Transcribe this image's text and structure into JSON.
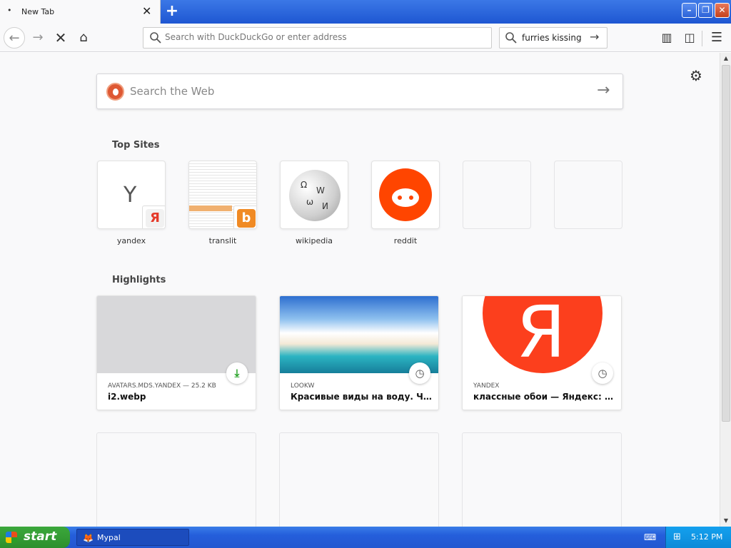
{
  "tab": {
    "title": "New Tab",
    "close": "✕",
    "new_tab": "+"
  },
  "window": {
    "minimize": "–",
    "maximize": "❐",
    "close": "✕"
  },
  "toolbar": {
    "back": "←",
    "forward": "→",
    "stop": "✕",
    "home": "⌂",
    "url_placeholder": "Search with DuckDuckGo or enter address",
    "search_value": "furries kissing",
    "search_go": "→",
    "library": "▥",
    "sidebar": "◫",
    "menu": "☰"
  },
  "content": {
    "settings": "⚙",
    "web_search": {
      "placeholder": "Search the Web",
      "go": "→"
    },
    "top_sites_title": "Top Sites",
    "top_sites": [
      {
        "label": "yandex",
        "letter": "Y",
        "badge": "Я"
      },
      {
        "label": "translit",
        "badge": "b"
      },
      {
        "label": "wikipedia"
      },
      {
        "label": "reddit"
      }
    ],
    "highlights_title": "Highlights",
    "highlights": [
      {
        "host": "AVATARS.MDS.YANDEX — 25.2 KB",
        "title": "i2.webp",
        "icon": "download-icon",
        "glyph": "⤓"
      },
      {
        "host": "LOOKW",
        "title": "Красивые виды на воду. Часть…",
        "icon": "clock-icon",
        "glyph": "◷"
      },
      {
        "host": "YANDEX",
        "title": "классные обои — Яндекс: наш…",
        "icon": "clock-icon",
        "glyph": "◷",
        "image_letter": "Я"
      }
    ]
  },
  "taskbar": {
    "start": "start",
    "task_label": "Mypal",
    "clock": "5:12 PM"
  }
}
